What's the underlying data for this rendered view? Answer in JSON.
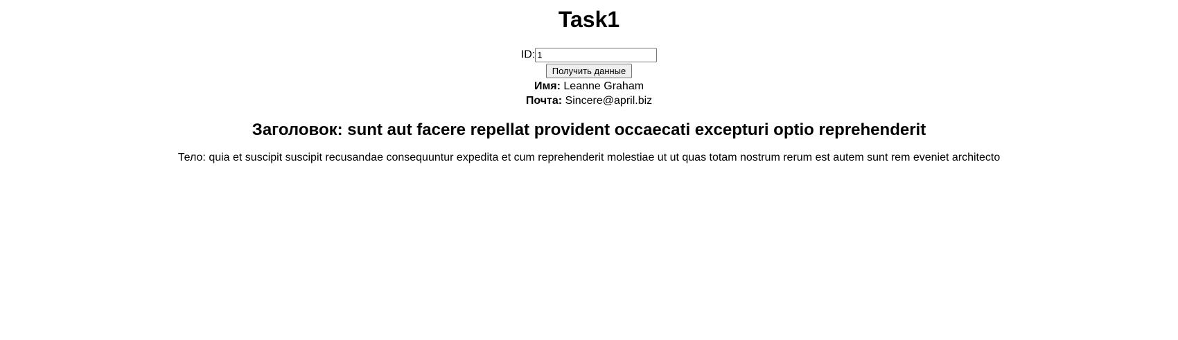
{
  "page": {
    "title": "Task1"
  },
  "form": {
    "id_label": "ID:",
    "id_value": "1",
    "submit_label": "Получить данные"
  },
  "user": {
    "name_label": "Имя:",
    "name_value": "Leanne Graham",
    "email_label": "Почта:",
    "email_value": "Sincere@april.biz"
  },
  "post": {
    "title_label": "Заголовок:",
    "title_value": "sunt aut facere repellat provident occaecati excepturi optio reprehenderit",
    "body_label": "Тело:",
    "body_value": "quia et suscipit suscipit recusandae consequuntur expedita et cum reprehenderit molestiae ut ut quas totam nostrum rerum est autem sunt rem eveniet architecto"
  }
}
